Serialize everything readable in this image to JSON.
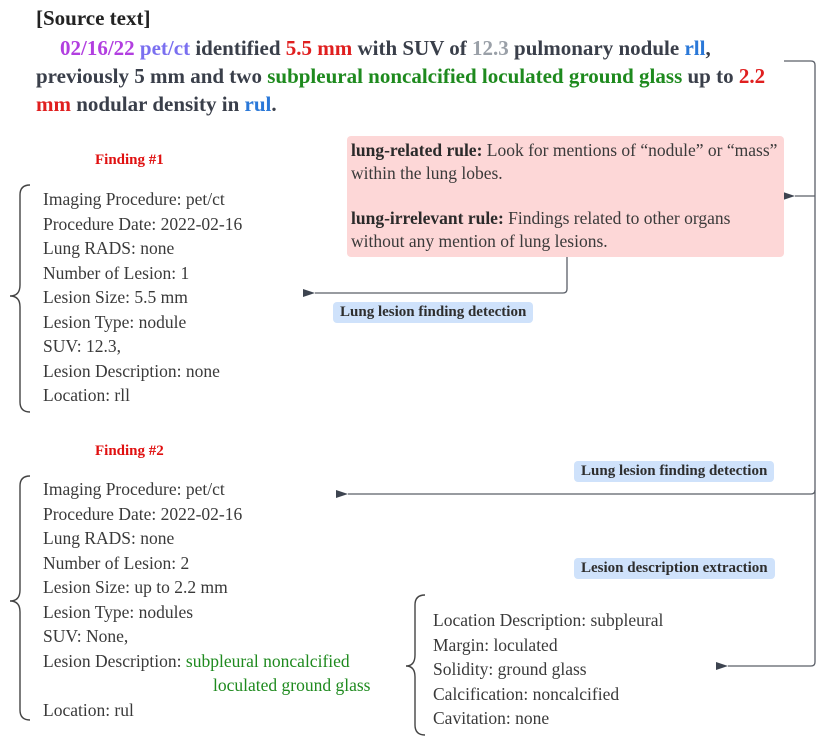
{
  "source": {
    "title": "[Source text]",
    "segments": {
      "date": "02/16/22",
      "procedure": "pet/ct",
      "t1": " identified ",
      "size1": "5.5 mm",
      "t2": " with SUV of ",
      "suv": "12.3",
      "t3": " pulmonary nodule ",
      "loc1": "rll",
      "t4": ", previously 5 mm and two ",
      "desc": "subpleural noncalcified loculated ground glass",
      "t5": " up to ",
      "size2": "2.2 mm",
      "t6": " nodular density in ",
      "loc2": "rul",
      "t7": "."
    }
  },
  "rules": {
    "related_label": "lung-related rule:",
    "related_text": " Look for mentions of “nodule” or “mass” within the lung lobes.",
    "irrelevant_label": "lung-irrelevant rule:",
    "irrelevant_text": " Findings related to other organs without any mention of lung lesions."
  },
  "tags": {
    "detection1": "Lung lesion finding detection",
    "detection2": "Lung lesion finding detection",
    "description": "Lesion description extraction"
  },
  "finding1": {
    "title": "Finding #1",
    "fields": [
      "Imaging Procedure: pet/ct",
      "Procedure Date: 2022-02-16",
      "Lung RADS: none",
      "Number of Lesion: 1",
      "Lesion Size: 5.5 mm",
      "Lesion Type: nodule",
      "SUV: 12.3,",
      "Lesion Description: none",
      "Location: rll"
    ]
  },
  "finding2": {
    "title": "Finding #2",
    "fields": [
      "Imaging Procedure: pet/ct",
      "Procedure Date: 2022-02-16",
      "Lung RADS: none",
      "Number of Lesion: 2",
      "Lesion Size: up to 2.2 mm",
      "Lesion Type: nodules",
      "SUV: None,"
    ],
    "desc_label": "Lesion Description: ",
    "desc_line1": "subpleural noncalcified",
    "desc_line2": "loculated ground glass",
    "location": "Location: rul"
  },
  "description": {
    "fields": [
      "Location Description: subpleural",
      "Margin: loculated",
      "Solidity: ground glass",
      "Calcification: noncalcified",
      "Cavitation: none"
    ]
  },
  "colors": {
    "date": "#b23fe0",
    "procedure": "#7a6ff0",
    "size": "#e01f1f",
    "suv": "#9aa0a8",
    "location": "#2a78d8",
    "description": "#1e8a1e",
    "rule_box": "#fdd7d7",
    "tag": "#cfe2fb",
    "finding_title": "#e01010"
  }
}
